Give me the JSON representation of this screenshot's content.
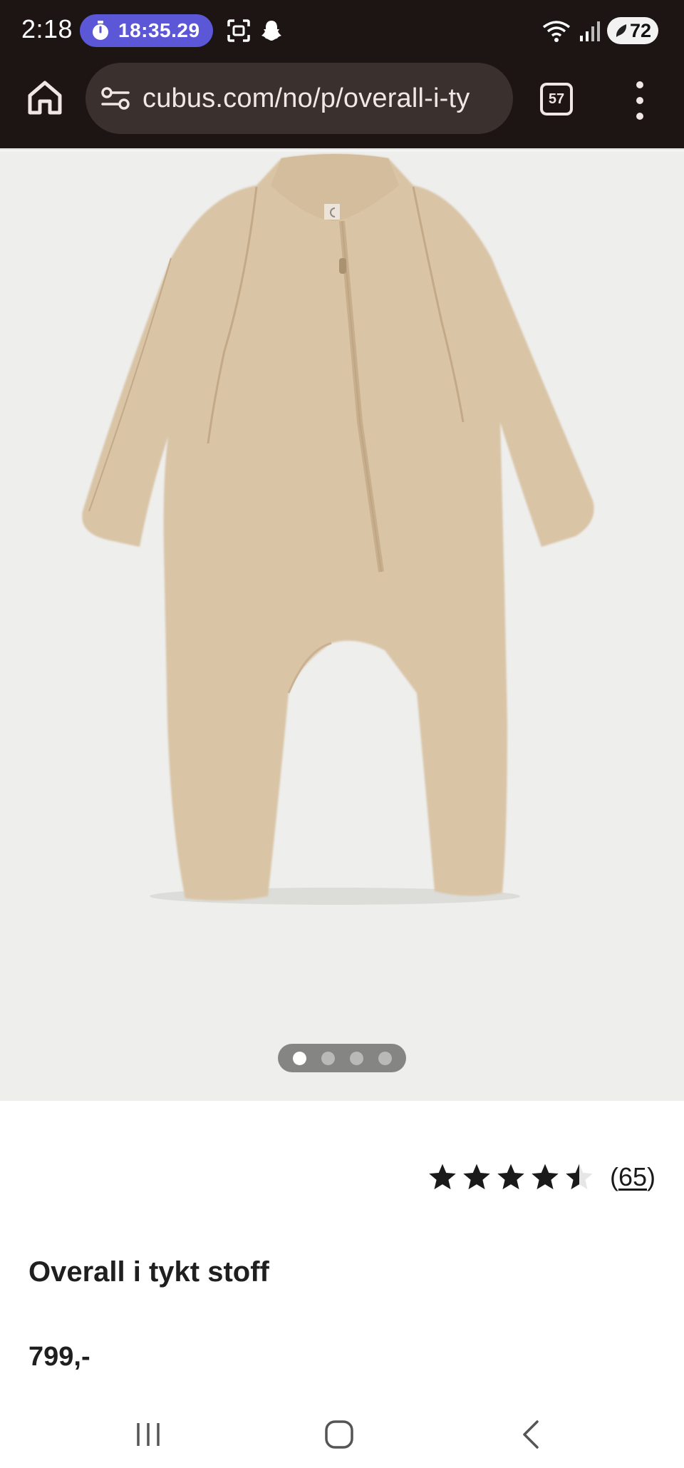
{
  "status_bar": {
    "time": "2:18",
    "timer": "18:35.29",
    "battery": "72",
    "icons": [
      "timer-icon",
      "screenshot-icon",
      "snapchat-icon",
      "wifi-icon",
      "signal-icon",
      "battery-icon"
    ]
  },
  "browser": {
    "url": "cubus.com/no/p/overall-i-ty",
    "tab_count": "57",
    "icons": [
      "home-icon",
      "site-settings-icon",
      "tabs-icon",
      "menu-icon"
    ]
  },
  "gallery": {
    "image_alt": "Overall i tykt stoff",
    "dot_count": 4,
    "active_index": 0
  },
  "product": {
    "rating": 4.5,
    "rating_count_open": "(",
    "rating_count": "65",
    "rating_count_close": ")",
    "title": "Overall i tykt stoff",
    "price": "799,-"
  },
  "nav": {
    "icons": [
      "recent-apps-icon",
      "home-icon",
      "back-icon"
    ]
  },
  "colors": {
    "chrome_bg": "#1d1513",
    "url_bg": "#3a302e",
    "timer_bg": "#5b57d6",
    "image_bg": "#eeeeec",
    "garment": "#d9c4a6",
    "star": "#1a1a1a"
  }
}
